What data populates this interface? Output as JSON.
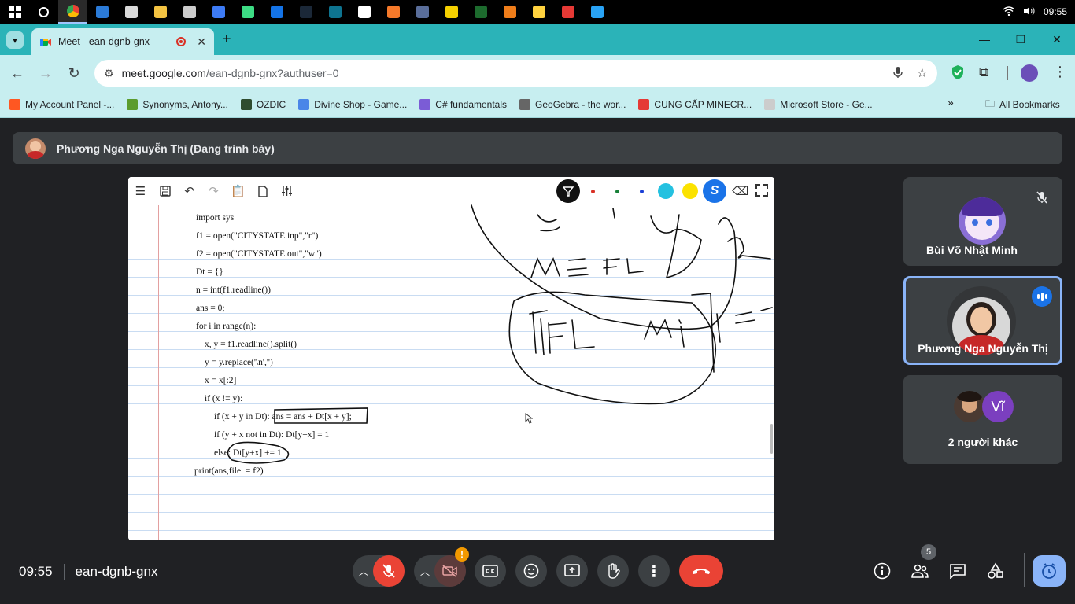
{
  "taskbar": {
    "clock": "09:55",
    "apps": [
      {
        "name": "windows-start-icon",
        "color": "#ffffff"
      },
      {
        "name": "search-icon",
        "color": "#ffffff"
      },
      {
        "name": "chrome-icon",
        "color": "#4285f4"
      },
      {
        "name": "vscode-icon",
        "color": "#2b7bd8"
      },
      {
        "name": "app-icon-1",
        "color": "#d9d9d9"
      },
      {
        "name": "folder-icon",
        "color": "#f3c342"
      },
      {
        "name": "check-icon",
        "color": "#cccccc"
      },
      {
        "name": "app-icon-2",
        "color": "#3d7bf5"
      },
      {
        "name": "android-icon",
        "color": "#3ddc84"
      },
      {
        "name": "app-icon-3",
        "color": "#1473e6"
      },
      {
        "name": "steam-icon",
        "color": "#1b2838"
      },
      {
        "name": "app-icon-4",
        "color": "#0e7490"
      },
      {
        "name": "app-icon-5",
        "color": "#ffffff"
      },
      {
        "name": "blender-icon",
        "color": "#f5792a"
      },
      {
        "name": "app-icon-6",
        "color": "#5a6e9a"
      },
      {
        "name": "app-icon-7",
        "color": "#f5d000"
      },
      {
        "name": "pt-icon",
        "color": "#1d6b2e"
      },
      {
        "name": "app-icon-8",
        "color": "#ef7d1a"
      },
      {
        "name": "app-icon-9",
        "color": "#ffd23f"
      },
      {
        "name": "record-icon",
        "color": "#e53935"
      },
      {
        "name": "app-icon-10",
        "color": "#29a3f5"
      }
    ]
  },
  "browser": {
    "tab_title": "Meet - ean-dgnb-gnx",
    "url_host": "meet.google.com",
    "url_path": "/ean-dgnb-gnx?authuser=0",
    "bookmarks": [
      {
        "label": "My Account Panel -...",
        "color": "#ff5722"
      },
      {
        "label": "Synonyms, Antony...",
        "color": "#5b9c2d"
      },
      {
        "label": "OZDIC",
        "color": "#2e4c2f"
      },
      {
        "label": "Divine Shop - Game...",
        "color": "#4a86e8"
      },
      {
        "label": "C# fundamentals",
        "color": "#7b5cd6"
      },
      {
        "label": "GeoGebra - the wor...",
        "color": "#666666"
      },
      {
        "label": "CUNG CẤP MINECR...",
        "color": "#e53935"
      },
      {
        "label": "Microsoft Store - Ge...",
        "color": "#cccccc"
      }
    ],
    "all_bookmarks": "All Bookmarks"
  },
  "meet": {
    "presenter": "Phương Nga Nguyễn Thị (Đang trình bày)",
    "meeting_time": "09:55",
    "meeting_code": "ean-dgnb-gnx",
    "participants_count": "5",
    "tiles": [
      {
        "name": "Bùi Võ Nhật Minh"
      },
      {
        "name": "Phương Nga Nguyễn Thị"
      },
      {
        "name": "2 người khác",
        "badge": "Vĩ"
      }
    ]
  },
  "whiteboard": {
    "code_lines": [
      "import sys",
      "f1 = open(\"CITYSTATE.inp\",\"r\")",
      "f2 = open(\"CITYSTATE.out\",\"w\")",
      "Dt = {}",
      "n = int(f1.readline())",
      "ans = 0;",
      "for i in range(n):",
      "    x, y = f1.readline().split()",
      "    y = y.replace('\\n','')",
      "    x = x[:2]",
      "    if (x != y):",
      "        if (x + y in Dt): ans = ans + Dt[x + y];",
      "        if (y + x not in Dt): Dt[y+x] = 1",
      "        else: Dt[y+x] += 1",
      "print(ans,file  = f2)"
    ],
    "pen_colors": [
      "#d93025",
      "#188038",
      "#1a3fd6",
      "#24c1e0",
      "#fbe200"
    ]
  }
}
